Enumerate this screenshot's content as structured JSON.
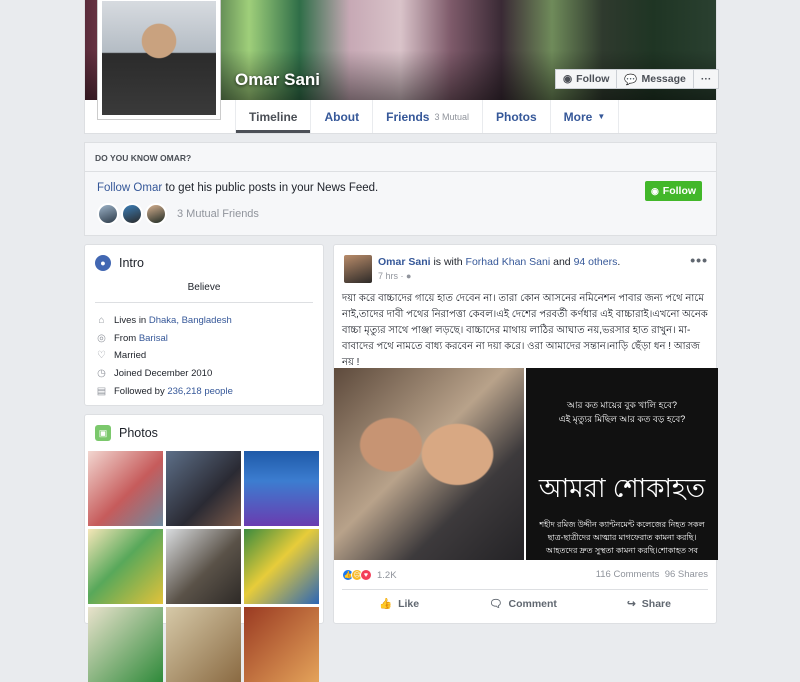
{
  "profile": {
    "name": "Omar Sani",
    "actions": {
      "follow": "Follow",
      "message": "Message",
      "more": "···"
    },
    "tabs": [
      {
        "label": "Timeline"
      },
      {
        "label": "About"
      },
      {
        "label": "Friends",
        "sub": "3 Mutual"
      },
      {
        "label": "Photos"
      },
      {
        "label": "More"
      }
    ]
  },
  "do_you_know": {
    "title": "DO YOU KNOW OMAR?",
    "follow_link": "Follow Omar",
    "text": " to get his public posts in your News Feed.",
    "follow_button": "Follow",
    "mutual_friends": "3 Mutual Friends"
  },
  "intro": {
    "title": "Intro",
    "bio": "Believe",
    "lives_prefix": "Lives in ",
    "lives_place": "Dhaka, Bangladesh",
    "from_prefix": "From ",
    "from_place": "Barisal",
    "relationship": "Married",
    "joined": "Joined December 2010",
    "followed_prefix": "Followed by ",
    "followers": "236,218 people"
  },
  "photos": {
    "title": "Photos"
  },
  "post": {
    "author": "Omar Sani",
    "with_text": " is with ",
    "with_name": "Forhad Khan Sani",
    "and_text": " and ",
    "others": "94 others",
    "time": "7 hrs",
    "more": "•••",
    "body": "দয়া করে বাচ্চাদের গায়ে হাত দেবেন না। তারা কোন আসনের নমিনেশন পাবার জন্য পথে নামে নাই,তাদের দাবী পথের নিরাপত্তা কেবল।এই দেশের পরবর্তী কর্ণধার এই বাচ্চারাই।এখনো অনেক বাচ্চা মৃত্যুর সাথে পাঞ্জা লড়ছে। বাচ্চাদের মাথায় লাঠির আঘাত নয়,ভরসার হাত রাখুন। মা-বাবাদের পথে নামতে বাধ্য করবেন না দয়া করে। ওরা আমাদের সন্তান।নাড়ি ছেঁড়া ধন ! আরজ নয় !",
    "image_top": "আর কত মায়ের বুক খালি হবে?\nএই মৃত্যুর মিছিল আর কত বড় হবে?",
    "image_main": "আমরা শোকাহত",
    "image_bottom": "শহীদ রমিজ উদ্দীন ক্যান্টনমেন্ট কলেজের নিহত সকল ছাত্র-ছাত্রীদের আত্মার মাগফেরাত কামনা করছি। আহতদের দ্রুত সুস্থতা কামনা করছি।শোকাহত সব",
    "reaction_count": "1.2K",
    "comments": "116 Comments",
    "shares": "96 Shares",
    "actions": {
      "like": "Like",
      "comment": "Comment",
      "share": "Share"
    }
  },
  "colors": {
    "facebook_blue": "#365899",
    "follow_green": "#42b72a",
    "background": "#e9ebee"
  }
}
